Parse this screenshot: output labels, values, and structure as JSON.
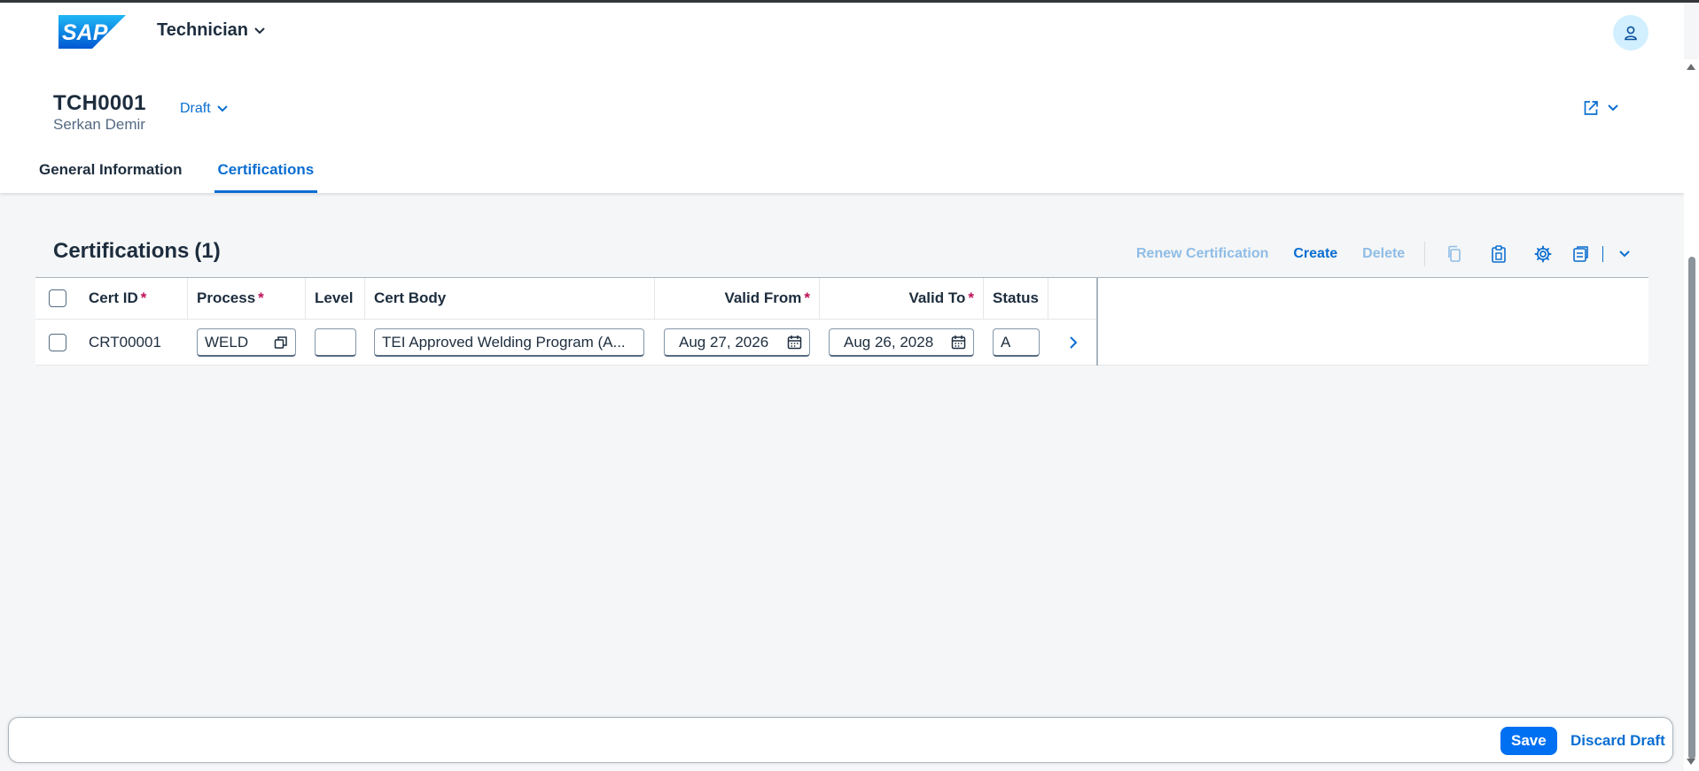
{
  "shell": {
    "logo_text": "SAP",
    "app_title": "Technician",
    "icons": {
      "title_dropdown": "chevron-down-icon",
      "avatar": "person-icon"
    }
  },
  "header": {
    "object_id": "TCH0001",
    "object_subtitle": "Serkan Demir",
    "draft_label": "Draft",
    "icons": {
      "share": "share-icon",
      "share_menu": "chevron-down-icon"
    }
  },
  "tabs": [
    {
      "label": "General Information",
      "active": false
    },
    {
      "label": "Certifications",
      "active": true
    }
  ],
  "section": {
    "title": "Certifications",
    "count": "(1)"
  },
  "toolbar": {
    "renew_label": "Renew Certification",
    "create_label": "Create",
    "delete_label": "Delete",
    "icons": [
      "copy-icon",
      "paste-icon",
      "settings-icon",
      "export-icon",
      "chevron-down-icon"
    ]
  },
  "table": {
    "columns": [
      {
        "label": "Cert ID",
        "required": true
      },
      {
        "label": "Process",
        "required": true
      },
      {
        "label": "Level",
        "required": false
      },
      {
        "label": "Cert Body",
        "required": false
      },
      {
        "label": "Valid From",
        "required": true
      },
      {
        "label": "Valid To",
        "required": true
      },
      {
        "label": "Status",
        "required": false
      }
    ],
    "rows": [
      {
        "cert_id": "CRT00001",
        "process": "WELD",
        "level": "",
        "cert_body": "TEI Approved Welding Program (A...",
        "valid_from": "Aug 27, 2026",
        "valid_to": "Aug 26, 2028",
        "status": "A"
      }
    ]
  },
  "footer": {
    "save_label": "Save",
    "discard_label": "Discard Draft"
  },
  "colors": {
    "brand_blue": "#0a6ed1",
    "emphasized": "#0070f2",
    "required": "#c0105a",
    "page_bg": "#f5f6f7"
  }
}
